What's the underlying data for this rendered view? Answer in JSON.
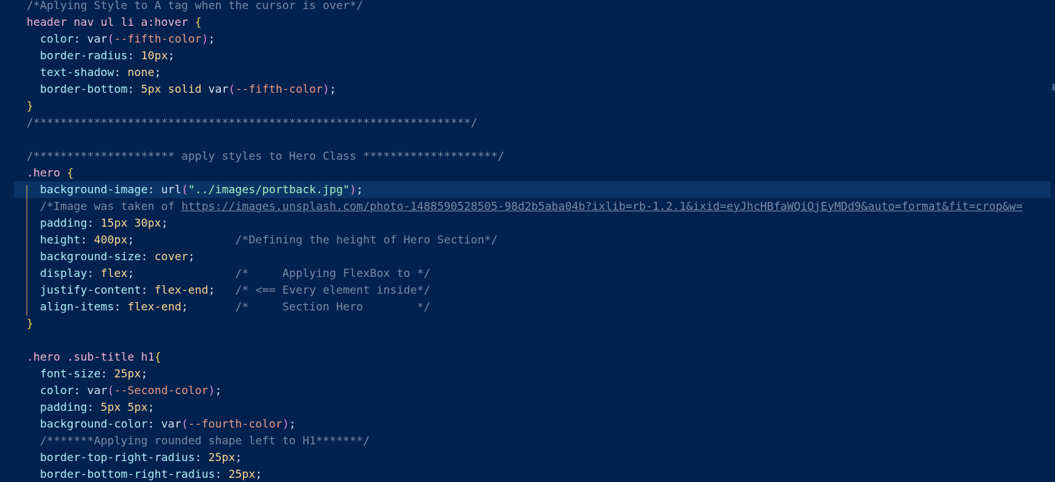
{
  "editor": {
    "lines": [
      "/*Aplying Style to A tag when the cursor is over*/",
      "header nav ul li a:hover {",
      "  color: var(--fifth-color);",
      "  border-radius: 10px;",
      "  text-shadow: none;",
      "  border-bottom: 5px solid var(--fifth-color);",
      "}",
      "/*****************************************************************/",
      "",
      "/********************* apply styles to Hero Class ********************/",
      ".hero {",
      "  background-image: url(\"../images/portback.jpg\");",
      "  /*Image was taken of https://images.unsplash.com/photo-1488590528505-98d2b5aba04b?ixlib=rb-1.2.1&ixid=eyJhcHBfaWQiOjEyMDd9&auto=format&fit=crop&w=",
      "  padding: 15px 30px;",
      "  height: 400px;               /*Defining the height of Hero Section*/",
      "  background-size: cover;",
      "  display: flex;               /*     Applying FlexBox to */",
      "  justify-content: flex-end;   /* <== Every element inside*/",
      "  align-items: flex-end;       /*     Section Hero        */",
      "}",
      "",
      ".hero .sub-title h1{",
      "  font-size: 25px;",
      "  color: var(--Second-color);",
      "  padding: 5px 5px;",
      "  background-color: var(--fourth-color);",
      "  /*******Applying rounded shape left to H1*******/",
      "  border-top-right-radius: 25px;",
      "  border-bottom-right-radius: 25px;"
    ],
    "active_line": 11,
    "colors": {
      "background": "#01214f",
      "active_line": "#0b3466",
      "comment": "#7a8ba8",
      "property": "#aef0f7",
      "value": "#ffd98f",
      "brace": "#f4d24c",
      "string": "#a6f2c0"
    }
  }
}
